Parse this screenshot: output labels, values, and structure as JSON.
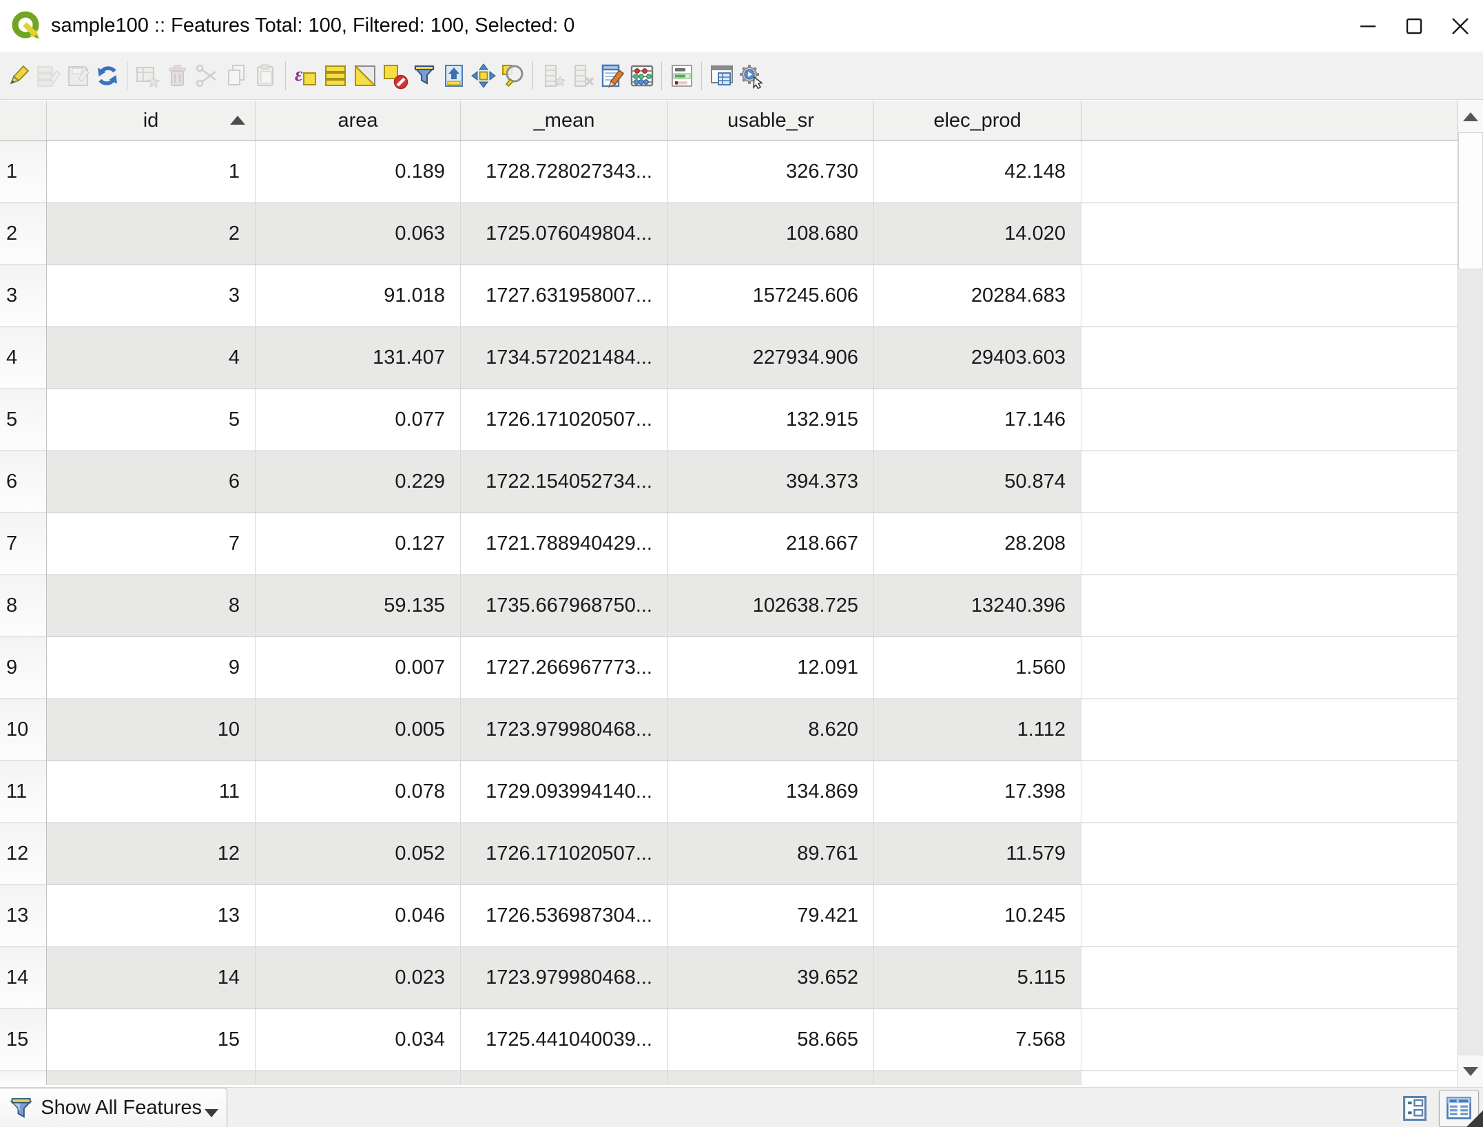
{
  "window": {
    "title": "sample100 :: Features Total: 100, Filtered: 100, Selected: 0",
    "app": "QGIS attribute table",
    "controls": [
      "minimize",
      "maximize",
      "close"
    ]
  },
  "toolbar": {
    "buttons": [
      {
        "icon": "toggle-editing-icon",
        "enabled": true
      },
      {
        "icon": "multi-edit-icon",
        "enabled": false
      },
      {
        "icon": "save-edits-icon",
        "enabled": false
      },
      {
        "icon": "reload-table-icon",
        "enabled": true
      },
      {
        "icon": "add-feature-icon",
        "enabled": false
      },
      {
        "icon": "delete-selected-icon",
        "enabled": false
      },
      {
        "icon": "cut-icon",
        "enabled": false
      },
      {
        "icon": "copy-icon",
        "enabled": false
      },
      {
        "icon": "paste-icon",
        "enabled": false
      },
      {
        "icon": "select-by-expression-icon",
        "enabled": true
      },
      {
        "icon": "select-all-icon",
        "enabled": true
      },
      {
        "icon": "invert-selection-icon",
        "enabled": true
      },
      {
        "icon": "deselect-all-icon",
        "enabled": true
      },
      {
        "icon": "filter-by-form-icon",
        "enabled": true
      },
      {
        "icon": "move-selection-to-top-icon",
        "enabled": true
      },
      {
        "icon": "pan-to-selection-icon",
        "enabled": true
      },
      {
        "icon": "zoom-to-selection-icon",
        "enabled": true
      },
      {
        "icon": "new-field-icon",
        "enabled": false
      },
      {
        "icon": "delete-field-icon",
        "enabled": false
      },
      {
        "icon": "edit-fields-icon",
        "enabled": true
      },
      {
        "icon": "field-calculator-icon",
        "enabled": true
      },
      {
        "icon": "conditional-formatting-icon",
        "enabled": true
      },
      {
        "icon": "dock-attribute-table-icon",
        "enabled": true
      },
      {
        "icon": "feature-actions-icon",
        "enabled": true
      }
    ]
  },
  "table": {
    "columns": [
      "id",
      "area",
      "_mean",
      "usable_sr",
      "elec_prod"
    ],
    "sorted_column": "id",
    "sort_direction": "ascending",
    "rows": [
      {
        "n": "1",
        "cells": [
          "1",
          "0.189",
          "1728.728027343...",
          "326.730",
          "42.148"
        ]
      },
      {
        "n": "2",
        "cells": [
          "2",
          "0.063",
          "1725.076049804...",
          "108.680",
          "14.020"
        ]
      },
      {
        "n": "3",
        "cells": [
          "3",
          "91.018",
          "1727.631958007...",
          "157245.606",
          "20284.683"
        ]
      },
      {
        "n": "4",
        "cells": [
          "4",
          "131.407",
          "1734.572021484...",
          "227934.906",
          "29403.603"
        ]
      },
      {
        "n": "5",
        "cells": [
          "5",
          "0.077",
          "1726.171020507...",
          "132.915",
          "17.146"
        ]
      },
      {
        "n": "6",
        "cells": [
          "6",
          "0.229",
          "1722.154052734...",
          "394.373",
          "50.874"
        ]
      },
      {
        "n": "7",
        "cells": [
          "7",
          "0.127",
          "1721.788940429...",
          "218.667",
          "28.208"
        ]
      },
      {
        "n": "8",
        "cells": [
          "8",
          "59.135",
          "1735.667968750...",
          "102638.725",
          "13240.396"
        ]
      },
      {
        "n": "9",
        "cells": [
          "9",
          "0.007",
          "1727.266967773...",
          "12.091",
          "1.560"
        ]
      },
      {
        "n": "10",
        "cells": [
          "10",
          "0.005",
          "1723.979980468...",
          "8.620",
          "1.112"
        ]
      },
      {
        "n": "11",
        "cells": [
          "11",
          "0.078",
          "1729.093994140...",
          "134.869",
          "17.398"
        ]
      },
      {
        "n": "12",
        "cells": [
          "12",
          "0.052",
          "1726.171020507...",
          "89.761",
          "11.579"
        ]
      },
      {
        "n": "13",
        "cells": [
          "13",
          "0.046",
          "1726.536987304...",
          "79.421",
          "10.245"
        ]
      },
      {
        "n": "14",
        "cells": [
          "14",
          "0.023",
          "1723.979980468...",
          "39.652",
          "5.115"
        ]
      },
      {
        "n": "15",
        "cells": [
          "15",
          "0.034",
          "1725.441040039...",
          "58.665",
          "7.568"
        ]
      }
    ]
  },
  "statusbar": {
    "filter_button_label": "Show All Features",
    "view_buttons": [
      {
        "icon": "form-view-icon",
        "active": false
      },
      {
        "icon": "table-view-icon",
        "active": true
      }
    ]
  },
  "colors": {
    "selection_yellow": "#f4dd46",
    "icon_blue": "#4a7ab5",
    "row_alternate": "#e8e8e7",
    "toolbar_bg": "#f1f1f1",
    "header_bg": "#f1f1f0"
  }
}
